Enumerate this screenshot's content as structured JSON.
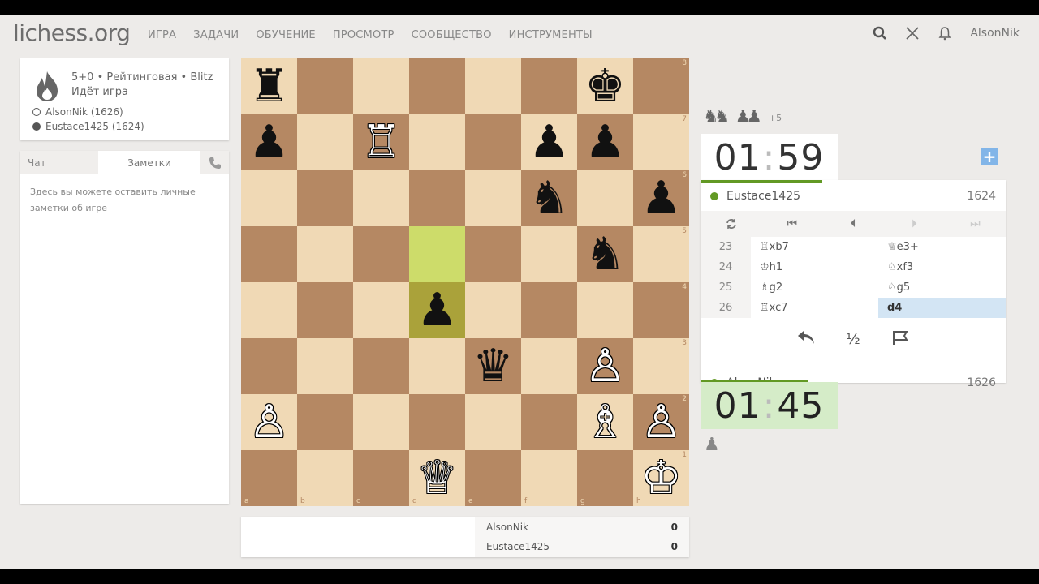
{
  "header": {
    "logo": "lichess.org",
    "nav": [
      "ИГРА",
      "ЗАДАЧИ",
      "ОБУЧЕНИЕ",
      "ПРОСМОТР",
      "СООБЩЕСТВО",
      "ИНСТРУМЕНТЫ"
    ],
    "username": "AlsonNik"
  },
  "game_info": {
    "type_line": "5+0 • Рейтинговая • Blitz",
    "status": "Идёт игра",
    "white_player": "AlsonNik (1626)",
    "black_player": "Eustace1425 (1624)"
  },
  "chat": {
    "tab_chat": "Чат",
    "tab_notes": "Заметки",
    "notes_placeholder": "Здесь вы можете оставить личные заметки об игре"
  },
  "board": {
    "ranks": [
      "8",
      "7",
      "6",
      "5",
      "4",
      "3",
      "2",
      "1"
    ],
    "files": [
      "a",
      "b",
      "c",
      "d",
      "e",
      "f",
      "g",
      "h"
    ],
    "pieces": [
      [
        "♜",
        "",
        "",
        "",
        "",
        "",
        "♚",
        ""
      ],
      [
        "♟",
        "",
        "♖",
        "",
        "",
        "♟",
        "♟",
        ""
      ],
      [
        "",
        "",
        "",
        "",
        "",
        "♞",
        "",
        "♟"
      ],
      [
        "",
        "",
        "",
        "",
        "",
        "",
        "♞",
        ""
      ],
      [
        "",
        "",
        "",
        "♟",
        "",
        "",
        "",
        ""
      ],
      [
        "",
        "",
        "",
        "",
        "♛",
        "",
        "♙",
        ""
      ],
      [
        "♙",
        "",
        "",
        "",
        "",
        "",
        "♗",
        "♙"
      ],
      [
        "",
        "",
        "",
        "♕",
        "",
        "",
        "",
        "♔"
      ]
    ],
    "colors": [
      [
        "b",
        "",
        "",
        "",
        "",
        "",
        "b",
        ""
      ],
      [
        "b",
        "",
        "w",
        "",
        "",
        "b",
        "b",
        ""
      ],
      [
        "",
        "",
        "",
        "",
        "",
        "b",
        "",
        "b"
      ],
      [
        "",
        "",
        "",
        "",
        "",
        "",
        "b",
        ""
      ],
      [
        "",
        "",
        "",
        "b",
        "",
        "",
        "",
        ""
      ],
      [
        "",
        "",
        "",
        "",
        "b",
        "",
        "w",
        ""
      ],
      [
        "w",
        "",
        "",
        "",
        "",
        "",
        "w",
        "w"
      ],
      [
        "",
        "",
        "",
        "w",
        "",
        "",
        "",
        "w"
      ]
    ],
    "highlight": [
      [
        3,
        3
      ],
      [
        4,
        3
      ]
    ]
  },
  "crosstable": {
    "rows": [
      {
        "name": "AlsonNik",
        "score": "0"
      },
      {
        "name": "Eustace1425",
        "score": "0"
      }
    ]
  },
  "material": {
    "pieces": [
      "♞",
      "♞",
      "♟",
      "♟"
    ],
    "diff": "+5"
  },
  "clock_top": {
    "min": "01",
    "sec": "59"
  },
  "clock_bottom": {
    "min": "01",
    "sec": "45"
  },
  "opponent": {
    "name": "Eustace1425",
    "rating": "1624"
  },
  "me": {
    "name": "AlsonNik",
    "rating": "1626"
  },
  "moves": [
    {
      "num": "23",
      "white": "♖xb7",
      "black": "♕e3+"
    },
    {
      "num": "24",
      "white": "♔h1",
      "black": "♘xf3"
    },
    {
      "num": "25",
      "white": "♗g2",
      "black": "♘g5"
    },
    {
      "num": "26",
      "white": "♖xc7",
      "black": "d4"
    }
  ],
  "colors": {
    "accent_green": "#629924",
    "move_active": "#d3e5f4",
    "clock_active": "#d5ecc8"
  }
}
